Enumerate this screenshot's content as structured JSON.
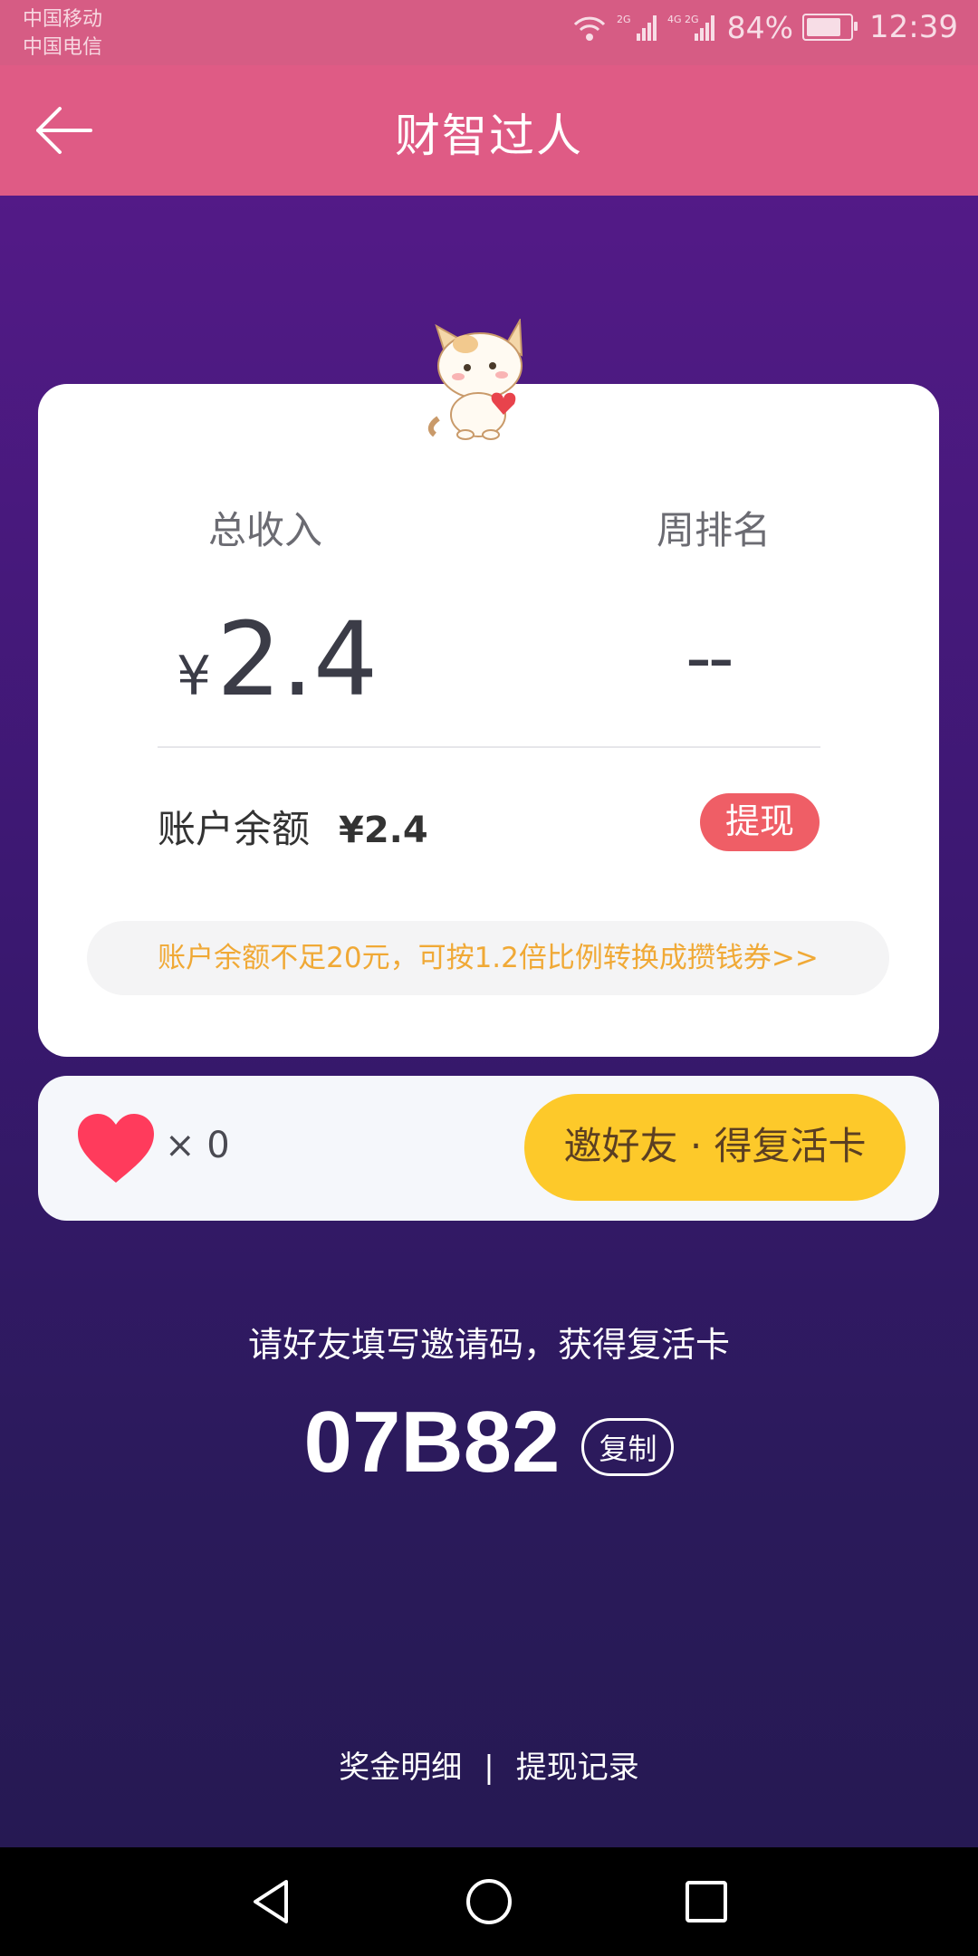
{
  "status_bar": {
    "carrier1": "中国移动",
    "carrier2": "中国电信",
    "signal1": "2G",
    "signal2": "4G 2G",
    "battery": "84%",
    "battery_level": 0.84,
    "time": "12:39"
  },
  "app_bar": {
    "title": "财智过人"
  },
  "earnings_card": {
    "total_income_label": "总收入",
    "total_income_currency": "¥",
    "total_income_value": "2.4",
    "weekly_rank_label": "周排名",
    "weekly_rank_value": "--",
    "balance_label": "账户余额",
    "balance_value": "¥2.4",
    "withdraw_label": "提现",
    "notice": "账户余额不足20元，可按1.2倍比例转换成攒钱券>>"
  },
  "lives": {
    "count_text": "× 0",
    "invite_button": "邀好友 · 得复活卡"
  },
  "invite": {
    "hint": "请好友填写邀请码，获得复活卡",
    "code": "07B82",
    "copy_label": "复制"
  },
  "footer": {
    "bonus_details": "奖金明细",
    "separator": "|",
    "withdraw_records": "提现记录"
  },
  "colors": {
    "status_bar": "#d65c84",
    "app_bar": "#df5b85",
    "bg_top": "#531a87",
    "bg_bottom": "#261953",
    "withdraw": "#ef5e66",
    "invite_button": "#fdc92a",
    "notice_text": "#f0a936",
    "heart": "#ff3b5c"
  }
}
